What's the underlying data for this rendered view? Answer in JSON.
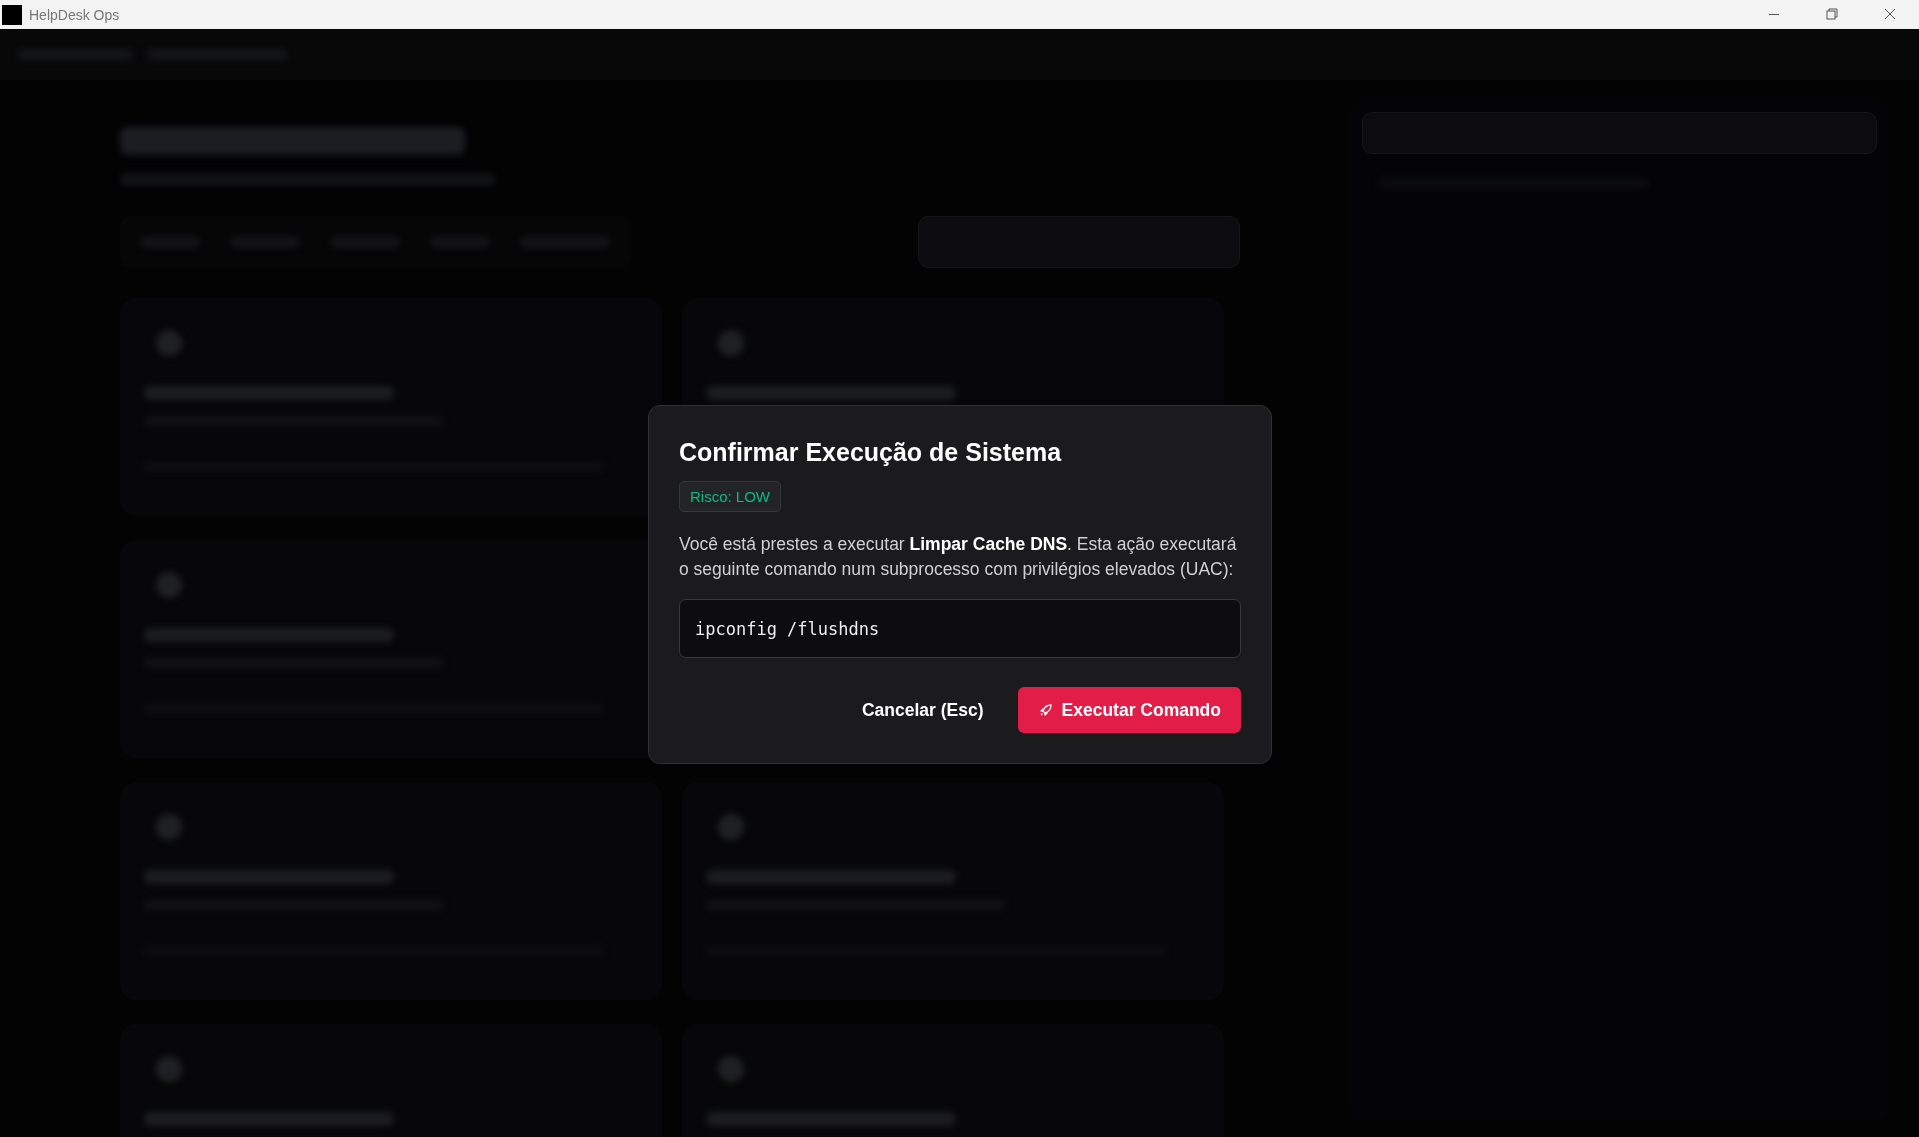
{
  "window": {
    "title": "HelpDesk Ops"
  },
  "dialog": {
    "title": "Confirmar Execução de Sistema",
    "risk": {
      "label": "Risco: LOW",
      "color": "#10b981"
    },
    "message": "Você está prestes a executar **Limpar Cache DNS**. Esta ação executará o seguinte comando num subprocesso com privilégios elevados (UAC):",
    "command": "ipconfig /flushdns",
    "buttons": [
      {
        "label": "Cancelar (Esc)",
        "kind": "cancel"
      },
      {
        "label": "Executar Comando",
        "kind": "confirm"
      }
    ]
  }
}
